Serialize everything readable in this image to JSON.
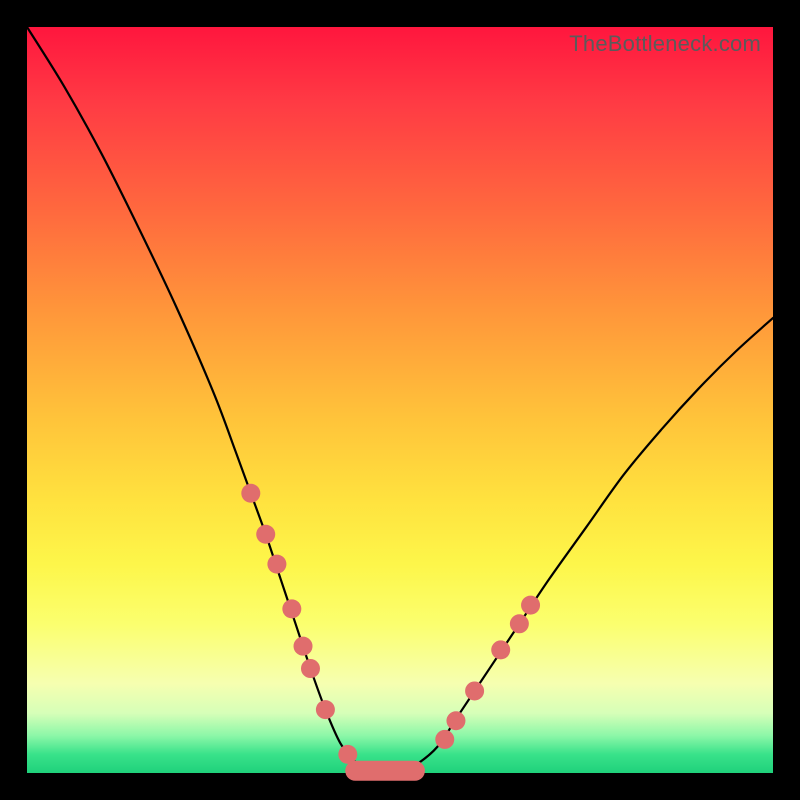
{
  "watermark": "TheBottleneck.com",
  "colors": {
    "frame": "#000000",
    "curve": "#000000",
    "marker": "#e06d6d",
    "gradient_top": "#ff163e",
    "gradient_bottom": "#1fd17b"
  },
  "chart_data": {
    "type": "line",
    "title": "",
    "xlabel": "",
    "ylabel": "",
    "xlim": [
      0,
      100
    ],
    "ylim": [
      0,
      100
    ],
    "grid": false,
    "legend": false,
    "notes": "Bottleneck-style V curve; y represents mismatch/bottleneck percentage (high=red=bad, low=green=good). No axis tick labels are rendered.",
    "series": [
      {
        "name": "bottleneck-curve",
        "x": [
          0,
          5,
          10,
          15,
          20,
          25,
          28,
          30,
          32,
          34,
          36,
          38,
          40,
          42,
          44,
          46,
          48,
          50,
          52,
          55,
          58,
          62,
          66,
          70,
          75,
          80,
          85,
          90,
          95,
          100
        ],
        "y": [
          100,
          92,
          83,
          73,
          62.5,
          51,
          43,
          37.5,
          32,
          26,
          20,
          14,
          8.5,
          4,
          1.5,
          0.2,
          0,
          0.2,
          1,
          3.5,
          8,
          14,
          20,
          26,
          33,
          40,
          46,
          51.5,
          56.5,
          61
        ]
      }
    ],
    "markers": {
      "name": "highlighted-points",
      "description": "Salmon dots/pills along the curve near the valley and on both flanks.",
      "points": [
        {
          "x": 30,
          "y": 37.5
        },
        {
          "x": 32,
          "y": 32
        },
        {
          "x": 33.5,
          "y": 28
        },
        {
          "x": 35.5,
          "y": 22
        },
        {
          "x": 37,
          "y": 17
        },
        {
          "x": 38,
          "y": 14
        },
        {
          "x": 40,
          "y": 8.5
        },
        {
          "x": 43,
          "y": 2.5
        },
        {
          "x": 56,
          "y": 4.5
        },
        {
          "x": 57.5,
          "y": 7
        },
        {
          "x": 60,
          "y": 11
        },
        {
          "x": 63.5,
          "y": 16.5
        },
        {
          "x": 66,
          "y": 20
        },
        {
          "x": 67.5,
          "y": 22.5
        }
      ],
      "valley_pill": {
        "x_start": 44,
        "x_end": 52,
        "y": 0.3
      }
    }
  }
}
